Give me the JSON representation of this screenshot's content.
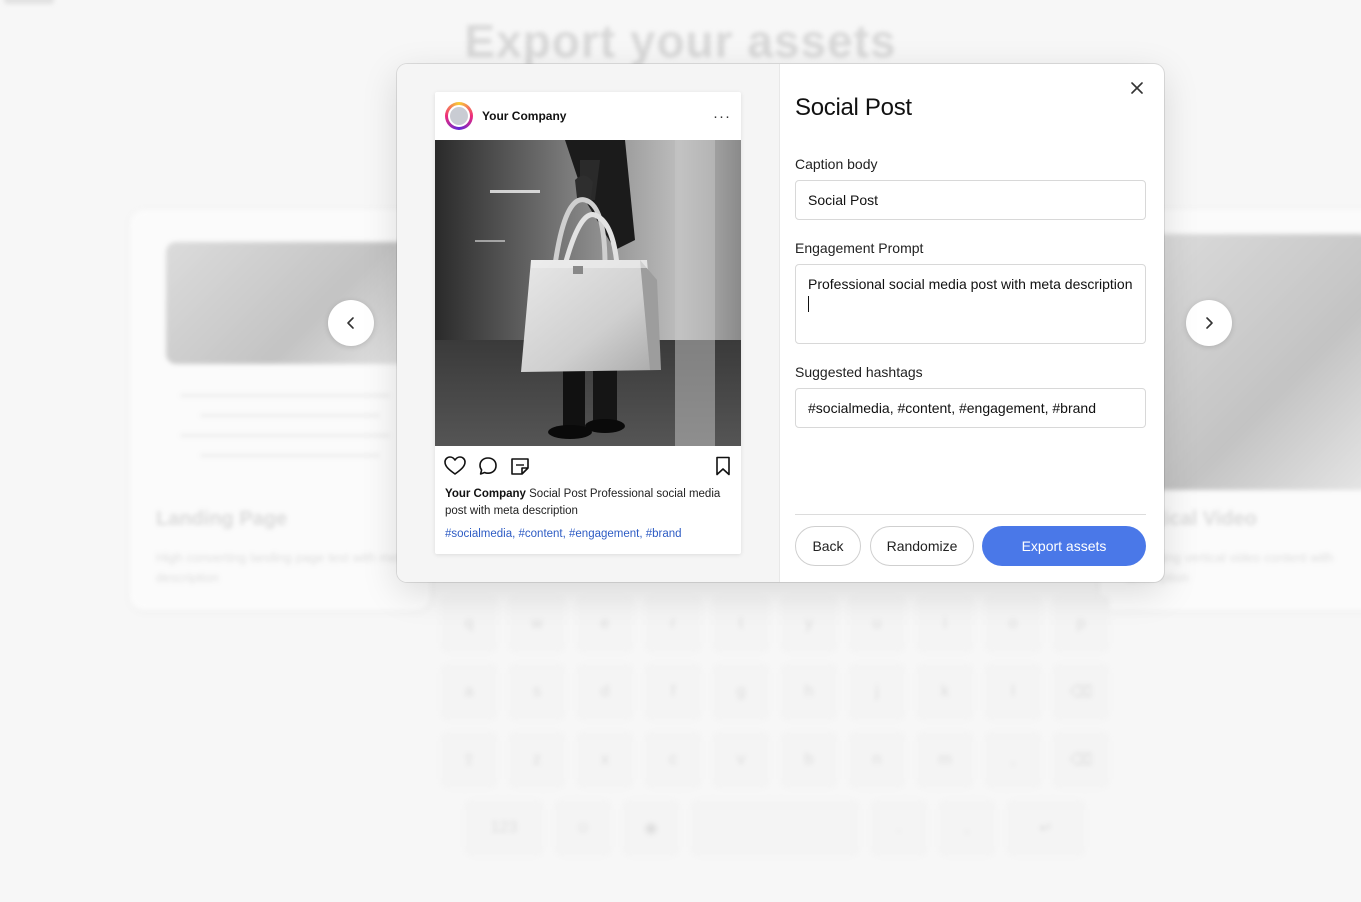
{
  "background": {
    "page_title": "Export your assets",
    "cards": [
      {
        "title": "Landing Page",
        "description": "High converting landing page text with meta description"
      },
      {
        "title": "Vertical Video",
        "description": "Engaging vertical video content with description"
      }
    ],
    "keyboard": {
      "row1": [
        "q",
        "w",
        "e",
        "r",
        "t",
        "y",
        "u",
        "i",
        "o",
        "p"
      ],
      "row2": [
        "a",
        "s",
        "d",
        "f",
        "g",
        "h",
        "j",
        "k",
        "l",
        "⌫"
      ],
      "row3": [
        "⇧",
        "z",
        "x",
        "c",
        "v",
        "b",
        "n",
        "m",
        ",",
        "⌫"
      ],
      "row4": [
        "123",
        "☺",
        "◉",
        "",
        ".",
        ",",
        "↵"
      ]
    }
  },
  "carousel": {
    "prev_icon": "chevron-left-icon",
    "next_icon": "chevron-right-icon"
  },
  "preview": {
    "account_name": "Your Company",
    "more_icon": "···",
    "caption_title": "Social Post",
    "caption_body": "Professional social media post with meta description",
    "hashtags": "#socialmedia, #content, #engagement, #brand",
    "icons": [
      "heart-icon",
      "comment-icon",
      "sticker-icon",
      "bookmark-icon"
    ]
  },
  "form": {
    "title": "Social Post",
    "caption_label": "Caption body",
    "caption_value": "Social Post",
    "engagement_label": "Engagement Prompt",
    "engagement_value": "Professional social media post with meta description",
    "hashtags_label": "Suggested hashtags",
    "hashtags_value": "#socialmedia, #content, #engagement, #brand",
    "back_label": "Back",
    "randomize_label": "Randomize",
    "export_label": "Export assets"
  },
  "colors": {
    "primary": "#4a78e8",
    "hashtag": "#2e5cc4",
    "preview_bg": "#f5f5f5"
  }
}
